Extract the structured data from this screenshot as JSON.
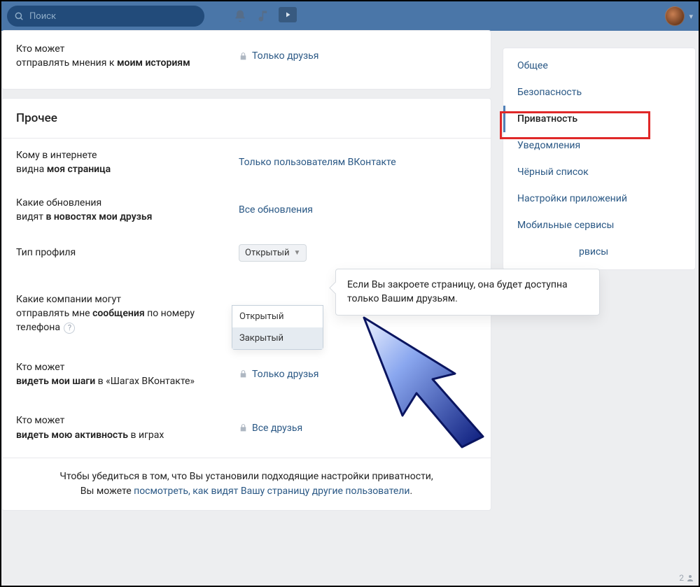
{
  "search": {
    "placeholder": "Поиск"
  },
  "top_section": {
    "label_line1": "Кто может",
    "label_line2_a": "отправлять мнения к ",
    "label_line2_b": "моим историям",
    "value": "Только друзья"
  },
  "section_title": "Прочее",
  "rows": {
    "r1": {
      "l1": "Кому в интернете",
      "l2a": "видна ",
      "l2b": "моя страница",
      "val": "Только пользователям ВКонтакте"
    },
    "r2": {
      "l1": "Какие обновления",
      "l2a": "видят ",
      "l2b": "в новостях мои друзья",
      "val": "Все обновления"
    },
    "r3": {
      "l1": "Тип профиля",
      "selected": "Открытый"
    },
    "r4": {
      "l1": "Какие компании могут",
      "l2a": "отправлять мне ",
      "l2b": "сообщения",
      "l2c": " по номеру телефона"
    },
    "r5": {
      "l1": "Кто может",
      "l2b": "видеть мои шаги",
      "l2c": " в «Шагах ВКонтакте»",
      "val": "Только друзья"
    },
    "r6": {
      "l1": "Кто может",
      "l2b": "видеть мою активность",
      "l2c": " в играх",
      "val": "Все друзья"
    }
  },
  "dropdown": {
    "opt1": "Открытый",
    "opt2": "Закрытый"
  },
  "tooltip": "Если Вы закроете страницу, она будет доступна только Вашим друзьям.",
  "footer": {
    "t1": "Чтобы убедиться в том, что Вы установили подходящие настройки приватности,",
    "t2a": "Вы можете ",
    "link": "посмотреть, как видят Вашу страницу другие пользователи",
    "t2b": "."
  },
  "sidebar": {
    "i1": "Общее",
    "i2": "Безопасность",
    "i3": "Приватность",
    "i4": "Уведомления",
    "i5": "Чёрный список",
    "i6": "Настройки приложений",
    "i7": "Мобильные сервисы",
    "i8_suffix": "рвисы"
  },
  "status_count": "2"
}
